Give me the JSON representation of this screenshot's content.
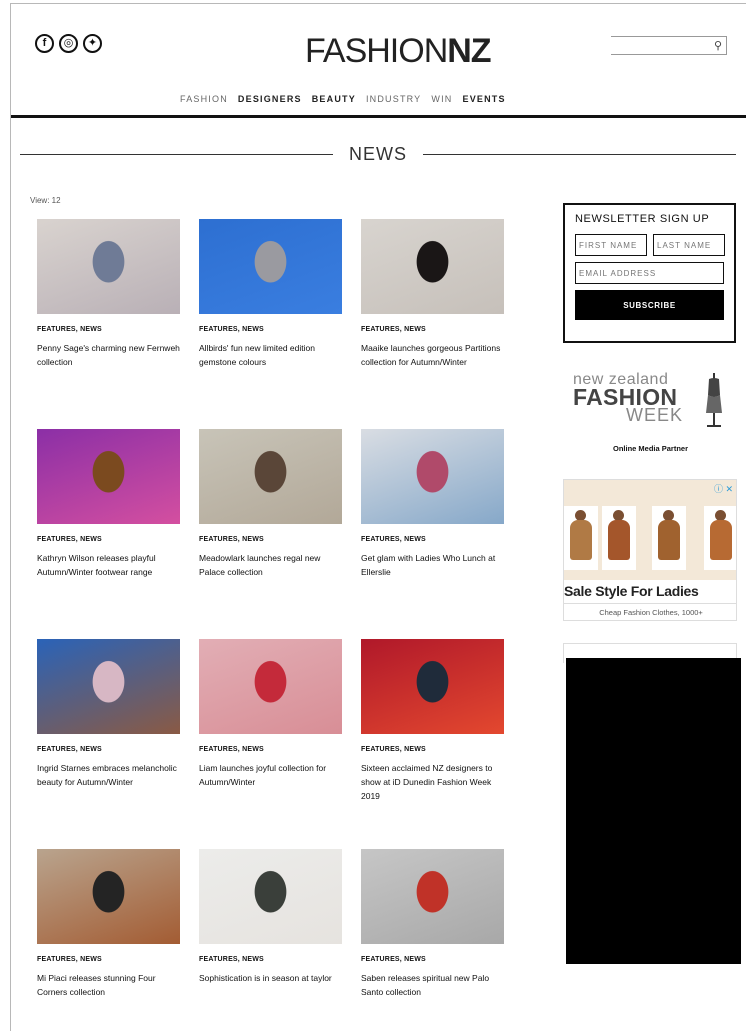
{
  "header": {
    "logo_light": "FASHION",
    "logo_bold": "NZ",
    "social_icons": [
      "facebook-icon",
      "instagram-icon",
      "twitter-icon"
    ],
    "search_placeholder": "",
    "nav": [
      {
        "label": "FASHION",
        "weight": "light"
      },
      {
        "label": "DESIGNERS",
        "weight": "bold"
      },
      {
        "label": "BEAUTY",
        "weight": "bold"
      },
      {
        "label": "INDUSTRY",
        "weight": "light"
      },
      {
        "label": "WIN",
        "weight": "light"
      },
      {
        "label": "EVENTS",
        "weight": "bold"
      }
    ]
  },
  "section_title": "NEWS",
  "view_label": "View: 12",
  "articles": [
    {
      "category": "FEATURES, NEWS",
      "title": "Penny Sage's charming new Fernweh collection",
      "img": [
        "#d9d3cf",
        "#b9b0b6",
        "#6f7b96"
      ]
    },
    {
      "category": "FEATURES, NEWS",
      "title": "Allbirds' fun new limited edition gemstone colours",
      "img": [
        "#2d6fd1",
        "#3a7ee0",
        "#9a9aa0"
      ]
    },
    {
      "category": "FEATURES, NEWS",
      "title": "Maaike launches gorgeous Partitions collection for Autumn/Winter",
      "img": [
        "#d8d4cf",
        "#c6c0ba",
        "#1a1616"
      ]
    },
    {
      "category": "FEATURES, NEWS",
      "title": "Kathryn Wilson releases playful Autumn/Winter footwear range",
      "img": [
        "#8b2fa6",
        "#d44fa0",
        "#7b4a1f"
      ]
    },
    {
      "category": "FEATURES, NEWS",
      "title": "Meadowlark launches regal new Palace collection",
      "img": [
        "#c8c4b8",
        "#b2a898",
        "#5a4638"
      ]
    },
    {
      "category": "FEATURES, NEWS",
      "title": "Get glam with Ladies Who Lunch at Ellerslie",
      "img": [
        "#d9dde3",
        "#86a8c9",
        "#b04a6a"
      ]
    },
    {
      "category": "FEATURES, NEWS",
      "title": "Ingrid Starnes embraces melancholic beauty for Autumn/Winter",
      "img": [
        "#2a63b8",
        "#8a5a44",
        "#d7b7c4"
      ]
    },
    {
      "category": "FEATURES, NEWS",
      "title": "Liam launches joyful collection for Autumn/Winter",
      "img": [
        "#e2aeb5",
        "#d88e96",
        "#c42a3a"
      ]
    },
    {
      "category": "FEATURES, NEWS",
      "title": "Sixteen acclaimed NZ designers to show at iD Dunedin Fashion Week 2019",
      "img": [
        "#b0182a",
        "#e3482f",
        "#1f2b3a"
      ]
    },
    {
      "category": "FEATURES, NEWS",
      "title": "Mi Piaci releases stunning Four Corners collection",
      "img": [
        "#b9a48e",
        "#a35c33",
        "#242424"
      ]
    },
    {
      "category": "FEATURES, NEWS",
      "title": "Sophistication is in season at taylor",
      "img": [
        "#ececea",
        "#e6e3df",
        "#3a3f3a"
      ]
    },
    {
      "category": "FEATURES, NEWS",
      "title": "Saben releases spiritual new Palo Santo collection",
      "img": [
        "#c6c6c6",
        "#a8a8a8",
        "#c03228"
      ]
    }
  ],
  "newsletter": {
    "heading": "NEWSLETTER SIGN UP",
    "first_name": "FIRST NAME",
    "last_name": "LAST NAME",
    "email": "EMAIL ADDRESS",
    "button": "SUBSCRIBE"
  },
  "nzfw": {
    "line1": "new zealand",
    "line2": "FASHION",
    "line3": "WEEK",
    "partner": "Online Media Partner"
  },
  "ad": {
    "headline": "Sale Style For Ladies",
    "sub": "Cheap Fashion Clothes, 1000+",
    "badge": "ⓘ ✕",
    "coat_colors": [
      "#b07a45",
      "#a4562b",
      "#a0622f",
      "#b76a33"
    ]
  }
}
